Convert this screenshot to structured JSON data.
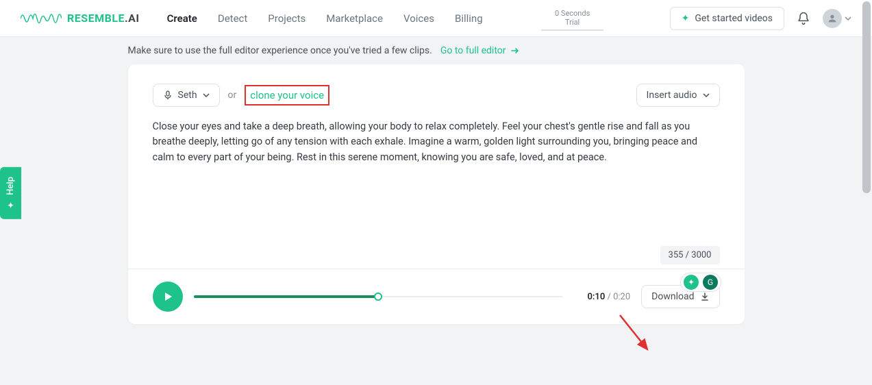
{
  "brand": {
    "name_a": "RESEMBLE",
    "name_b": ".AI"
  },
  "nav": {
    "items": [
      "Create",
      "Detect",
      "Projects",
      "Marketplace",
      "Voices",
      "Billing"
    ],
    "active": 0
  },
  "trial": {
    "line1": "0 Seconds",
    "line2": "Trial"
  },
  "header": {
    "get_started": "Get started videos"
  },
  "top_message": {
    "text": "Make sure to use the full editor experience once you've tried a few clips.",
    "link": "Go to full editor"
  },
  "editor": {
    "voice_name": "Seth",
    "or": "or",
    "clone": "clone your voice",
    "insert_audio": "Insert audio",
    "body": "Close your eyes and take a deep breath, allowing your body to relax completely. Feel your chest's gentle rise and fall as you breathe deeply, letting go of any tension with each exhale. Imagine a warm, golden light surrounding you, bringing peace and calm to every part of your being. Rest in this serene moment, knowing you are safe, loved, and at peace.",
    "char_count": "355 / 3000"
  },
  "player": {
    "current": "0:10",
    "total": "0:20",
    "download": "Download"
  },
  "help": {
    "label": "Help"
  }
}
